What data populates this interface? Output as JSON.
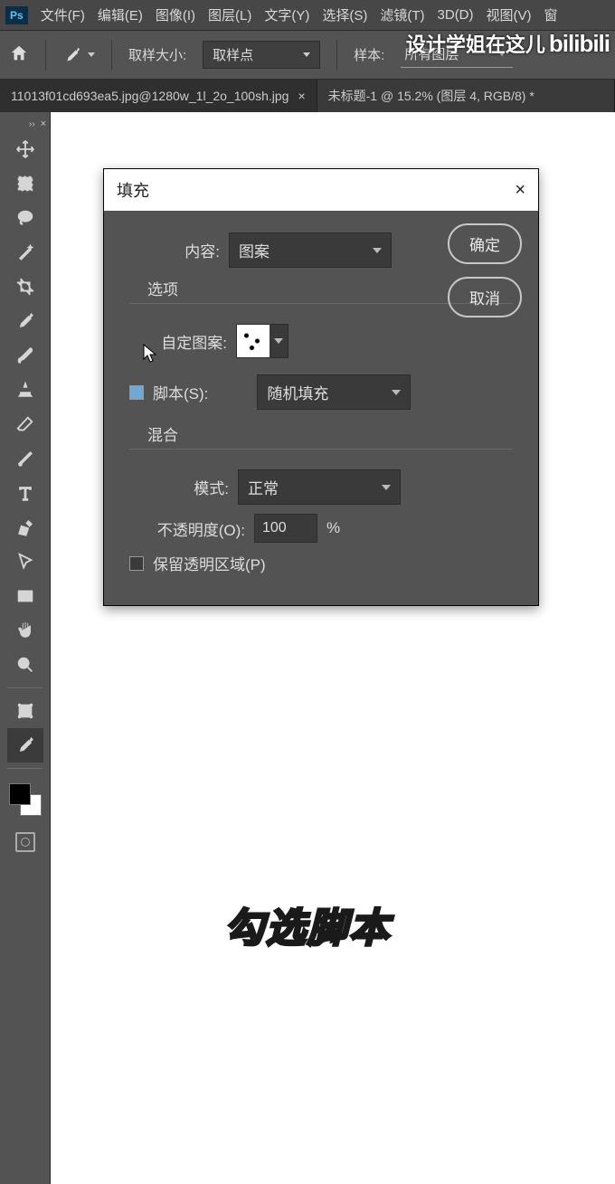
{
  "app": {
    "badge": "Ps"
  },
  "menu": {
    "items": [
      "文件(F)",
      "编辑(E)",
      "图像(I)",
      "图层(L)",
      "文字(Y)",
      "选择(S)",
      "滤镜(T)",
      "3D(D)",
      "视图(V)",
      "窗"
    ]
  },
  "watermark": {
    "text": "设计学姐在这儿",
    "brand": "bilibili"
  },
  "optbar": {
    "sample_size_label": "取样大小:",
    "sample_size_value": "取样点",
    "sample_label": "样本:",
    "sample_value": "所有图层"
  },
  "tabs": {
    "items": [
      {
        "label": "11013f01cd693ea5.jpg@1280w_1l_2o_100sh.jpg",
        "active": false
      },
      {
        "label": "未标题-1 @ 15.2% (图层 4, RGB/8) *",
        "active": true
      }
    ]
  },
  "dialog": {
    "title": "填充",
    "close": "×",
    "content_label": "内容:",
    "content_value": "图案",
    "ok": "确定",
    "cancel": "取消",
    "options_label": "选项",
    "custom_pattern_label": "自定图案:",
    "script_label": "脚本(S):",
    "script_value": "随机填充",
    "blend_label": "混合",
    "mode_label": "模式:",
    "mode_value": "正常",
    "opacity_label": "不透明度(O):",
    "opacity_value": "100",
    "percent": "%",
    "preserve_label": "保留透明区域(P)"
  },
  "caption": "勾选脚本"
}
